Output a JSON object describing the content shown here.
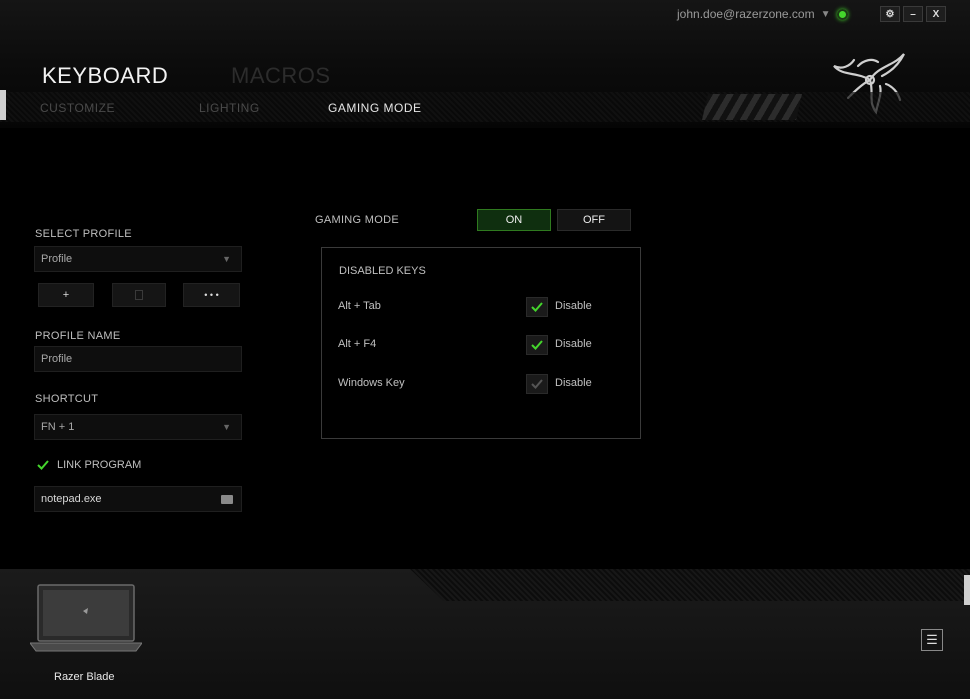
{
  "header": {
    "user_email": "john.doe@razerzone.com",
    "main_tabs": [
      {
        "label": "KEYBOARD",
        "active": true
      },
      {
        "label": "MACROS",
        "active": false
      }
    ],
    "sub_tabs": [
      {
        "label": "CUSTOMIZE",
        "active": false
      },
      {
        "label": "LIGHTING",
        "active": false
      },
      {
        "label": "GAMING MODE",
        "active": true
      }
    ],
    "window_buttons": {
      "settings": "⚙",
      "minimize": "–",
      "close": "X"
    }
  },
  "sidebar": {
    "select_profile_label": "SELECT PROFILE",
    "profile_dropdown_value": "Profile",
    "add_button": "+",
    "delete_button": "",
    "more_button": "• • •",
    "profile_name_label": "PROFILE NAME",
    "profile_name_value": "Profile",
    "shortcut_label": "SHORTCUT",
    "shortcut_value": "FN + 1",
    "link_program_label": "LINK PROGRAM",
    "link_program_checked": true,
    "program_path": "notepad.exe"
  },
  "gaming_mode": {
    "label": "GAMING MODE",
    "on_label": "ON",
    "off_label": "OFF",
    "state": "ON",
    "disabled_keys_title": "DISABLED KEYS",
    "keys": [
      {
        "name": "Alt + Tab",
        "action": "Disable",
        "checked": true
      },
      {
        "name": "Alt + F4",
        "action": "Disable",
        "checked": true
      },
      {
        "name": "Windows Key",
        "action": "Disable",
        "checked": false
      }
    ]
  },
  "footer": {
    "device_name": "Razer Blade",
    "menu_icon": "☰"
  },
  "colors": {
    "accent_green": "#44d62c",
    "background": "#000000"
  }
}
